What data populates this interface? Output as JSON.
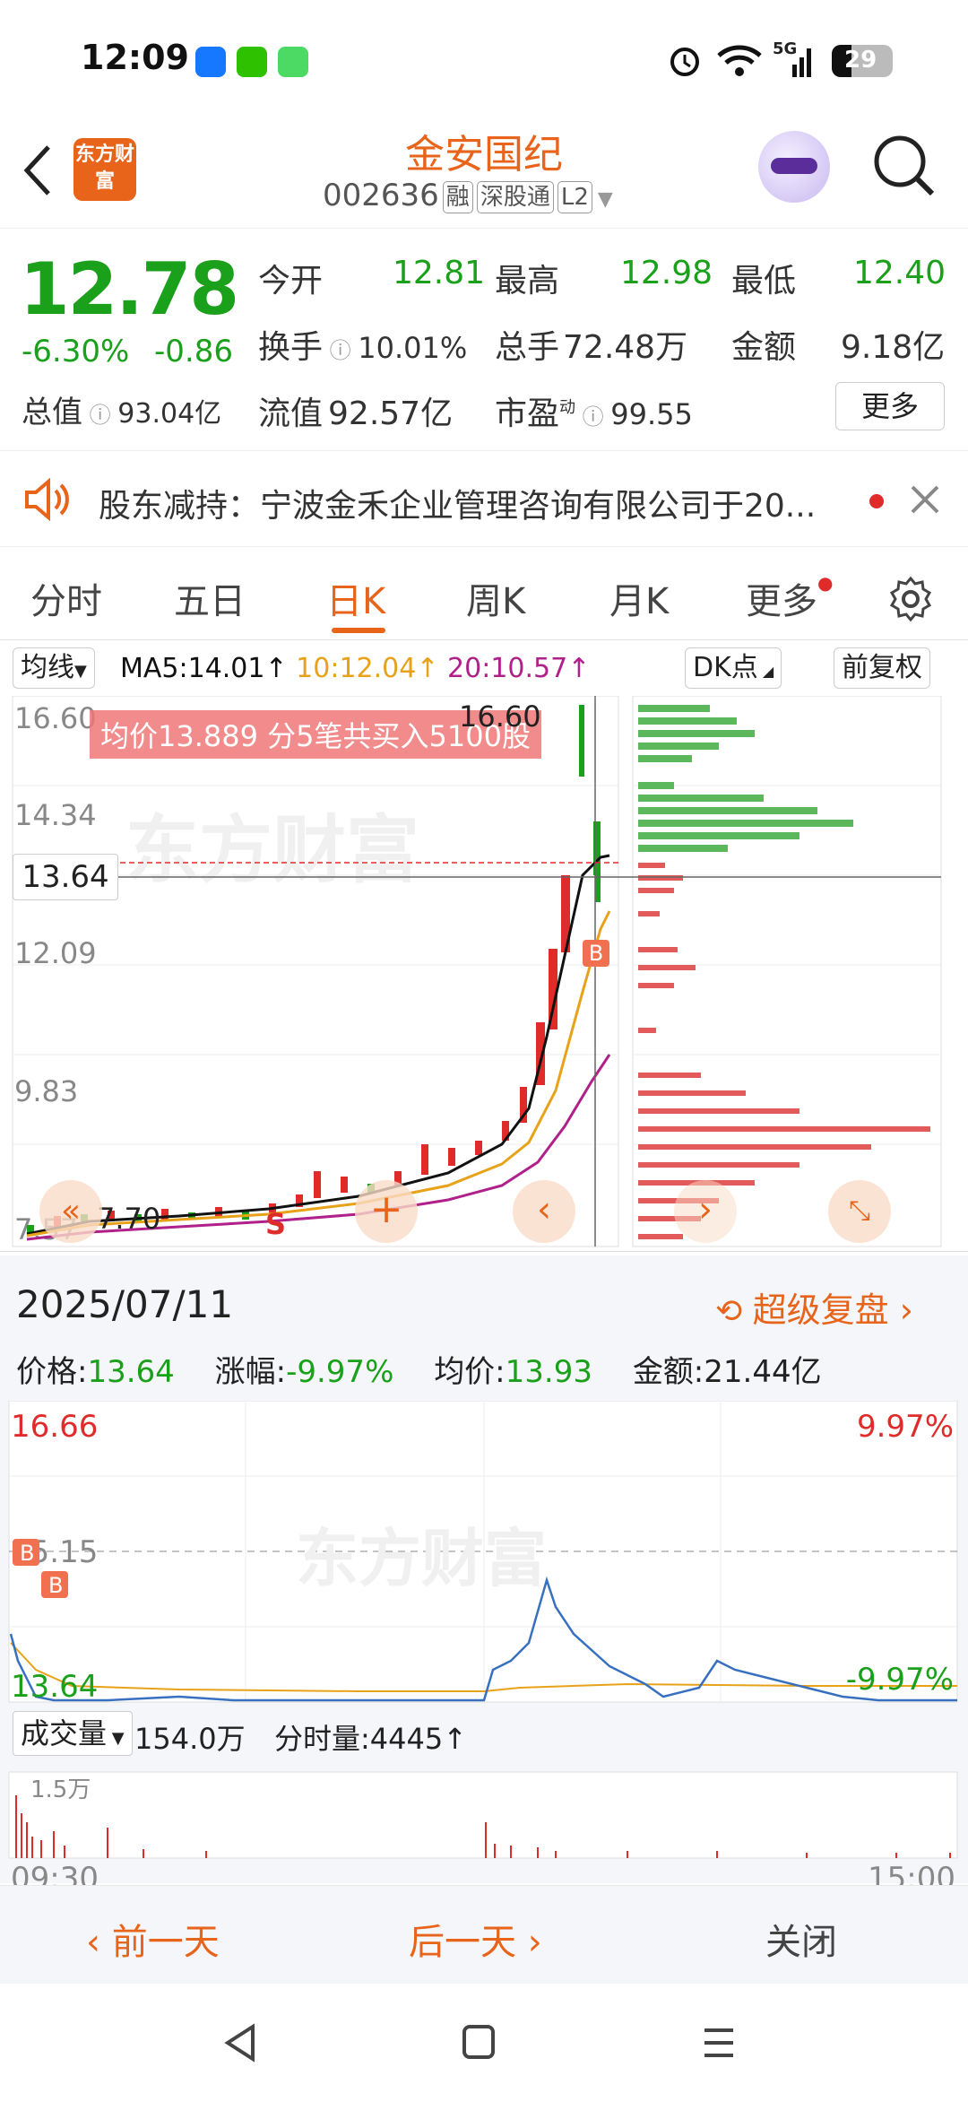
{
  "status": {
    "time": "12:09",
    "network": "5G",
    "battery": "29"
  },
  "header": {
    "logo_text": "东方财富",
    "title": "金安国纪",
    "code": "002636",
    "tags": [
      "融",
      "深股通",
      "L2"
    ]
  },
  "quote": {
    "price": "12.78",
    "change_pct": "-6.30%",
    "change_amt": "-0.86",
    "open_label": "今开",
    "open": "12.81",
    "high_label": "最高",
    "high": "12.98",
    "low_label": "最低",
    "low": "12.40",
    "turnover_label": "换手",
    "turnover": "10.01%",
    "volume_label": "总手",
    "volume": "72.48万",
    "amount_label": "金额",
    "amount": "9.18亿",
    "mktcap_label": "总值",
    "mktcap": "93.04亿",
    "float_label": "流值",
    "float_cap": "92.57亿",
    "pe_label": "市盈",
    "pe_sup": "动",
    "pe": "99.55",
    "more_label": "更多"
  },
  "notice": {
    "text": "股东减持：宁波金禾企业管理咨询有限公司于20..."
  },
  "tabs": [
    "分时",
    "五日",
    "日K",
    "周K",
    "月K",
    "更多"
  ],
  "active_tab": "日K",
  "kline": {
    "indicator_label": "均线",
    "ma5": "MA5:14.01↑",
    "ma10": "10:12.04↑",
    "ma20": "20:10.57↑",
    "dk_label": "DK点",
    "adjust_label": "前复权",
    "y_ticks": [
      "16.60",
      "14.34",
      "12.09",
      "9.83",
      "7.57"
    ],
    "crosshair_price": "13.64",
    "banner": "均价13.889  分5笔共买入5100股",
    "high_marker": "16.60",
    "low_marker": "7.70",
    "buy_mark": "B",
    "sell_mark": "S",
    "watermark": "东方财富",
    "colors": {
      "ma5": "#111111",
      "ma10": "#e8a21a",
      "ma20": "#b0208a",
      "up": "#e02b2b",
      "down": "#1aa01a"
    }
  },
  "intraday": {
    "date": "2025/07/11",
    "review_label": "超级复盘",
    "price_label": "价格:",
    "price": "13.64",
    "chg_label": "涨幅:",
    "chg": "-9.97%",
    "avg_label": "均价:",
    "avg": "13.93",
    "amt_label": "金额:",
    "amt": "21.44亿",
    "y_top": "16.66",
    "y_mid": "15.15",
    "y_bottom": "13.64",
    "pct_top": "9.97%",
    "pct_bottom": "-9.97%",
    "vol_label": "成交量",
    "vol_total": "154.0万",
    "vol_tick_label": "分时量:4445↑",
    "vol_axis": "1.5万",
    "time_start": "09:30",
    "time_end": "15:00",
    "marker_b": "B",
    "watermark": "东方财富"
  },
  "footer": {
    "prev": "前一天",
    "next": "后一天",
    "close": "关闭"
  }
}
